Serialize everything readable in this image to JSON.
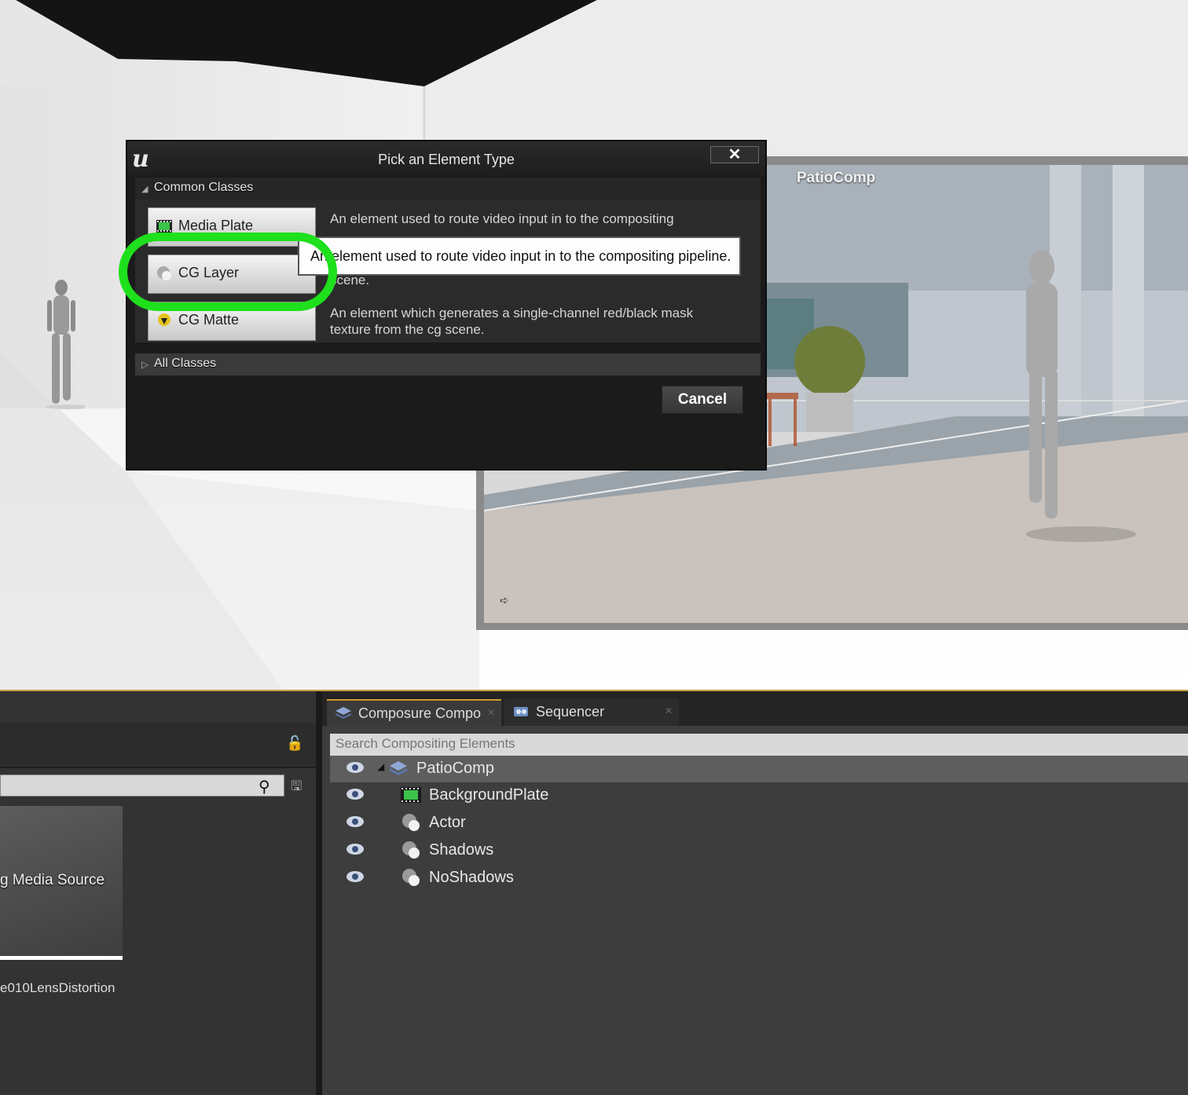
{
  "dialog": {
    "title": "Pick an Element Type",
    "close": "✕",
    "common_classes": "Common Classes",
    "all_classes": "All Classes",
    "cancel": "Cancel",
    "classes": [
      {
        "label": "Media Plate",
        "icon": "film-icon",
        "description": "An element used to route video input in to the compositing pipeline"
      },
      {
        "label": "CG Layer",
        "icon": "cg-layer-icon",
        "description": "scene."
      },
      {
        "label": "CG Matte",
        "icon": "matte-icon",
        "description": "An element which generates a single-channel red/black mask texture from the cg scene."
      }
    ],
    "tooltip": "An element used to route video input in to the compositing pipeline."
  },
  "preview": {
    "title": "PatioComp"
  },
  "left_panel": {
    "asset_tile_label": "g Media Source",
    "asset_name": "e010LensDistortion"
  },
  "tabs": [
    {
      "label": "Composure Compo",
      "icon": "composure-icon"
    },
    {
      "label": "Sequencer",
      "icon": "sequencer-icon"
    }
  ],
  "compositing": {
    "search_placeholder": "Search Compositing Elements",
    "elements": [
      {
        "label": "PatioComp",
        "icon": "comp-layers-icon",
        "level": 0,
        "expanded": true
      },
      {
        "label": "BackgroundPlate",
        "icon": "film-icon",
        "level": 1
      },
      {
        "label": "Actor",
        "icon": "cg-layer-icon",
        "level": 1
      },
      {
        "label": "Shadows",
        "icon": "cg-layer-icon",
        "level": 1
      },
      {
        "label": "NoShadows",
        "icon": "cg-layer-icon",
        "level": 1
      }
    ]
  },
  "colors": {
    "highlight": "#1ee01c",
    "tab_accent": "#d09a2a",
    "film_icon": "#3bc24a"
  }
}
